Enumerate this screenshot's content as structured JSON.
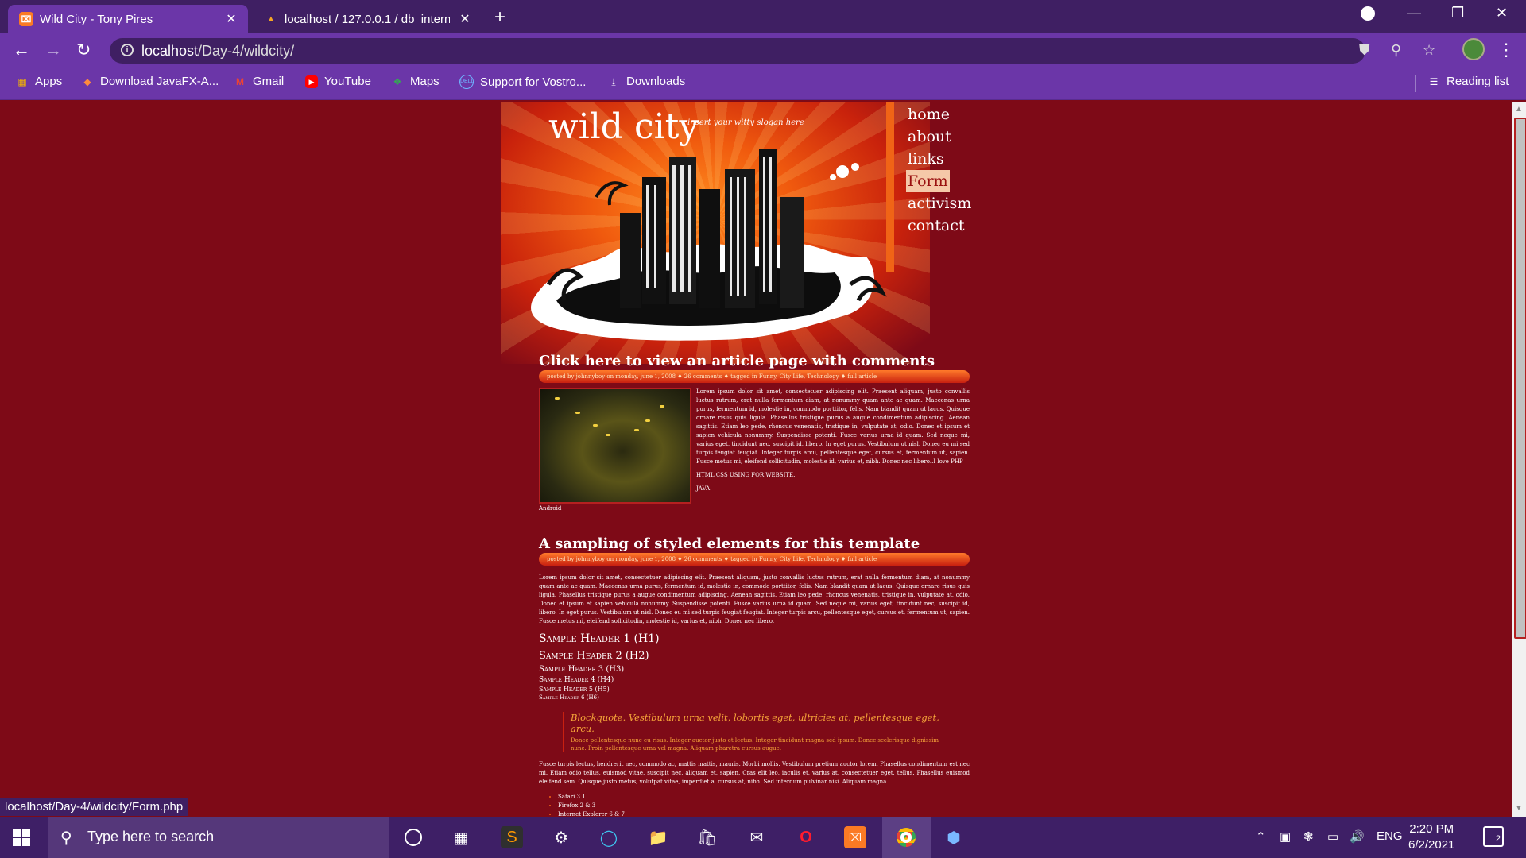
{
  "browser": {
    "tabs": [
      {
        "title": "Wild City - Tony Pires",
        "active": true
      },
      {
        "title": "localhost / 127.0.0.1 / db_interns",
        "active": false
      }
    ],
    "url_host": "localhost",
    "url_path": "/Day-4/wildcity/",
    "bookmarks": [
      {
        "label": "Apps",
        "icon": "apps-grid-icon"
      },
      {
        "label": "Download JavaFX-A...",
        "icon": "javafx-icon"
      },
      {
        "label": "Gmail",
        "icon": "gmail-icon"
      },
      {
        "label": "YouTube",
        "icon": "youtube-icon"
      },
      {
        "label": "Maps",
        "icon": "maps-icon"
      },
      {
        "label": "Support for Vostro...",
        "icon": "dell-icon"
      },
      {
        "label": "Downloads",
        "icon": "download-icon"
      }
    ],
    "reading_list": "Reading list",
    "status_url": "localhost/Day-4/wildcity/Form.php"
  },
  "site": {
    "title": "wild city",
    "slogan": "insert your witty slogan here",
    "nav": [
      "home",
      "about",
      "links",
      "Form",
      "activism",
      "contact"
    ],
    "current_nav": "Form"
  },
  "post1": {
    "title": "Click here to view an article page with comments",
    "meta": "posted by johnnyboy on monday, june 1, 2008  ♦  26 comments  ♦  tagged in Funny, City Life, Technology  ♦  full article",
    "body": "Lorem ipsum dolor sit amet, consectetuer adipiscing elit. Praesent aliquam, justo convallis luctus rutrum, erat nulla fermentum diam, at nonummy quam ante ac quam. Maecenas urna purus, fermentum id, molestie in, commodo porttitor, felis. Nam blandit quam ut lacus. Quisque ornare risus quis ligula. Phasellus tristique purus a augue condimentum adipiscing. Aenean sagittis. Etiam leo pede, rhoncus venenatis, tristique in, vulputate at, odio. Donec et ipsum et sapien vehicula nonummy. Suspendisse potenti. Fusce varius urna id quam. Sed neque mi, varius eget, tincidunt nec, suscipit id, libero. In eget purus. Vestibulum ut nisl. Donec eu mi sed turpis feugiat feugiat. Integer turpis arcu, pellentesque eget, cursus et, fermentum ut, sapien. Fusce metus mi, eleifend sollicitudin, molestie id, varius et, nibh. Donec nec libero..I love PHP",
    "line2": "HTML CSS USING FOR WEBSITE.",
    "line3": "JAVA",
    "caption": "Android"
  },
  "post2": {
    "title": "A sampling of styled elements for this template",
    "meta": "posted by johnnyboy on monday, june 1, 2008  ♦  26 comments  ♦  tagged in Funny, City Life, Technology  ♦  full article",
    "para1": "Lorem ipsum dolor sit amet, consectetuer adipiscing elit. Praesent aliquam, justo convallis luctus rutrum, erat nulla fermentum diam, at nonummy quam ante ac quam. Maecenas urna purus, fermentum id, molestie in, commodo porttitor, felis. Nam blandit quam ut lacus. Quisque ornare risus quis ligula. Phasellus tristique purus a augue condimentum adipiscing. Aenean sagittis. Etiam leo pede, rhoncus venenatis, tristique in, vulputate at, odio. Donec et ipsum et sapien vehicula nonummy. Suspendisse potenti. Fusce varius urna id quam. Sed neque mi, varius eget, tincidunt nec, suscipit id, libero. In eget purus. Vestibulum ut nisl. Donec eu mi sed turpis feugiat feugiat. Integer turpis arcu, pellentesque eget, cursus et, fermentum ut, sapien. Fusce metus mi, eleifend sollicitudin, molestie id, varius et, nibh. Donec nec libero.",
    "h1": "Sample Header 1 (H1)",
    "h2": "Sample Header 2 (H2)",
    "h3": "Sample Header 3 (H3)",
    "h4": "Sample Header 4 (H4)",
    "h5": "Sample Header 5 (H5)",
    "h6": "Sample Header 6 (H6)",
    "blockquote_head": "Blockquote. Vestibulum urna velit, lobortis eget, ultricies at, pellentesque eget, arcu.",
    "blockquote_body": "Donec pellentesque nunc eu risus. Integer auctor justo et lectus. Integer tincidunt magna sed ipsum. Donec scelerisque dignissim nunc. Proin pellentesque urna vel magna. Aliquam pharetra cursus augue.",
    "para2": "Fusce turpis lectus, hendrerit nec, commodo ac, mattis mattis, mauris. Morbi mollis. Vestibulum pretium auctor lorem. Phasellus condimentum est nec mi. Etiam odio tellus, euismod vitae, suscipit nec, aliquam et, sapien. Cras elit leo, iaculis et, varius at, consectetuer eget, tellus. Phasellus euismod eleifend sem. Quisque justo metus, volutpat vitae, imperdiet a, cursus at, nibh. Sed interdum pulvinar nisi. Aliquam magna.",
    "list": [
      "Safari 3.1",
      "Firefox 2 & 3",
      "Internet Explorer 6 & 7"
    ]
  },
  "taskbar": {
    "search_placeholder": "Type here to search",
    "language": "ENG",
    "time": "2:20 PM",
    "date": "6/2/2021",
    "notifications": "2"
  },
  "colors": {
    "page_bg": "#7e0a17",
    "chrome_purple": "#6b36a8",
    "accent_orange": "#f06416"
  }
}
